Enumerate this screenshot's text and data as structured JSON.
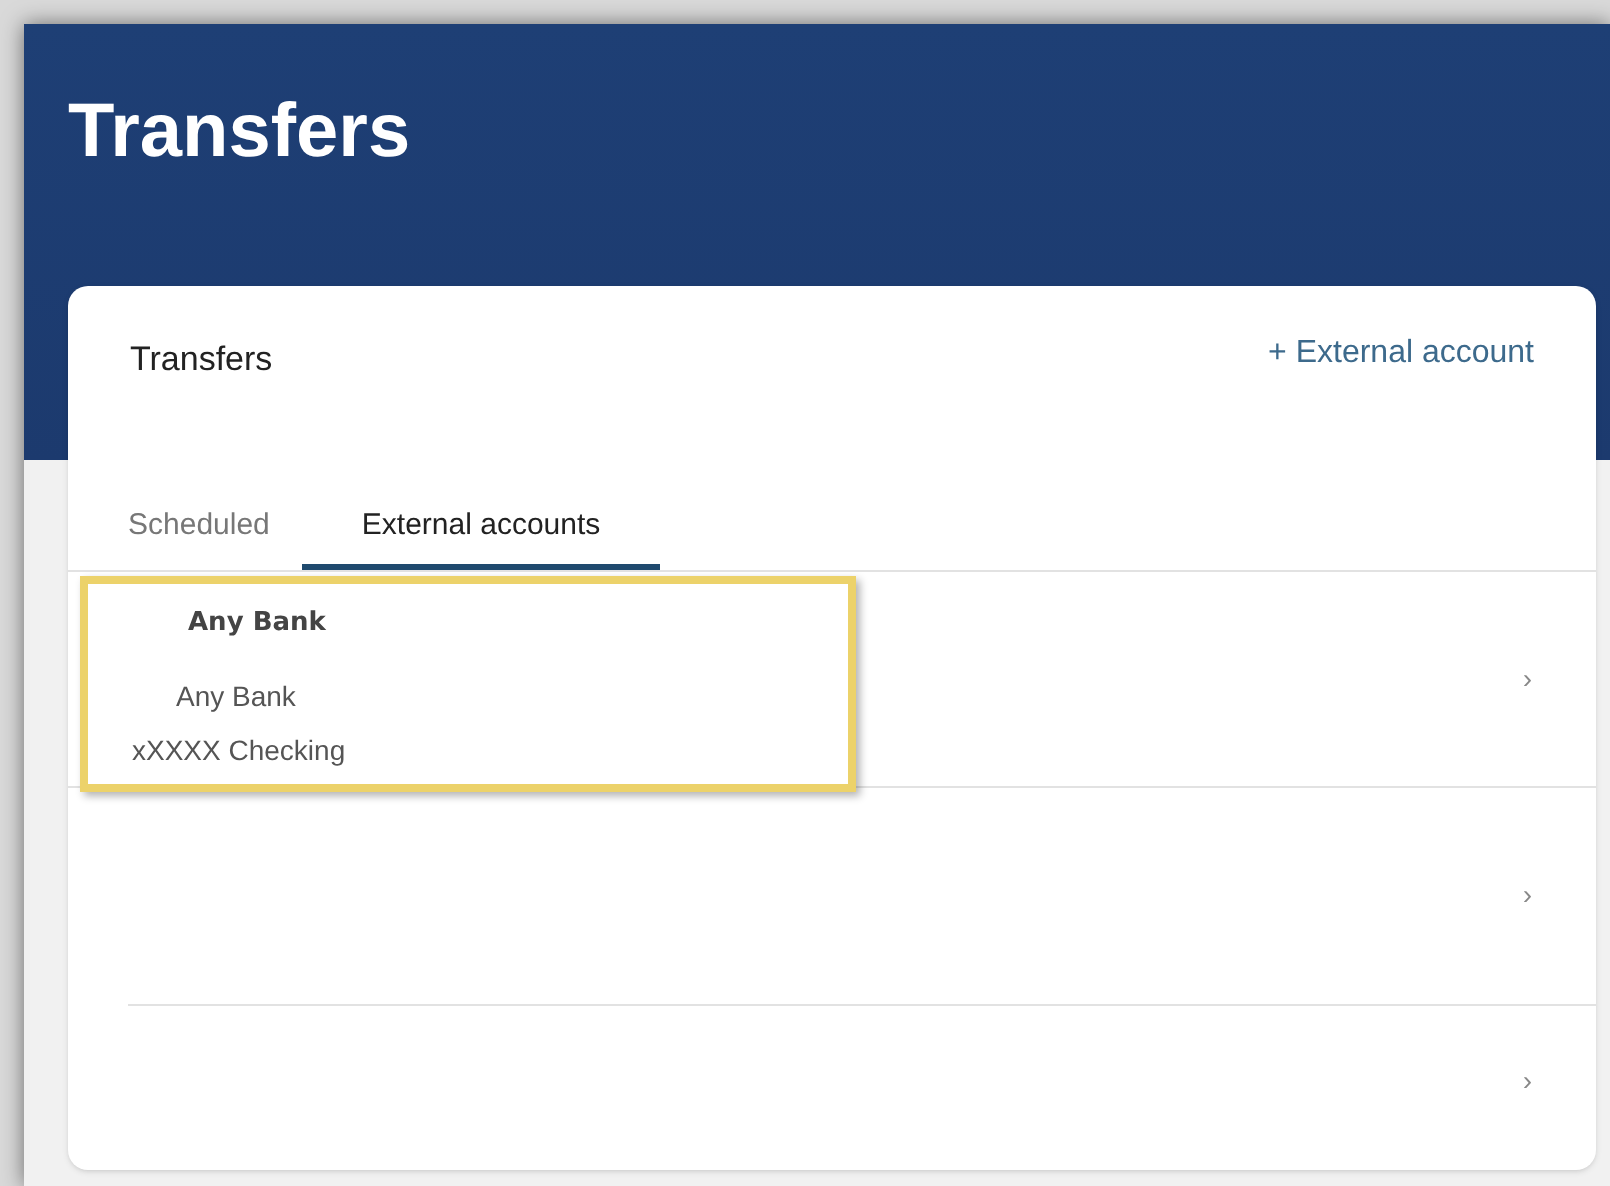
{
  "header": {
    "title": "Transfers"
  },
  "card": {
    "title": "Transfers",
    "action": "+ External account"
  },
  "tabs": [
    {
      "label": "Scheduled",
      "selected": false
    },
    {
      "label": "External accounts",
      "selected": true
    }
  ],
  "rows": [
    {
      "name": "Any Bank",
      "bank": "Any Bank",
      "account": "xXXXX Checking",
      "highlighted": true,
      "chevron": "›"
    },
    {
      "highlighted": false,
      "chevron": "›"
    },
    {
      "highlighted": false,
      "chevron": "›"
    }
  ]
}
